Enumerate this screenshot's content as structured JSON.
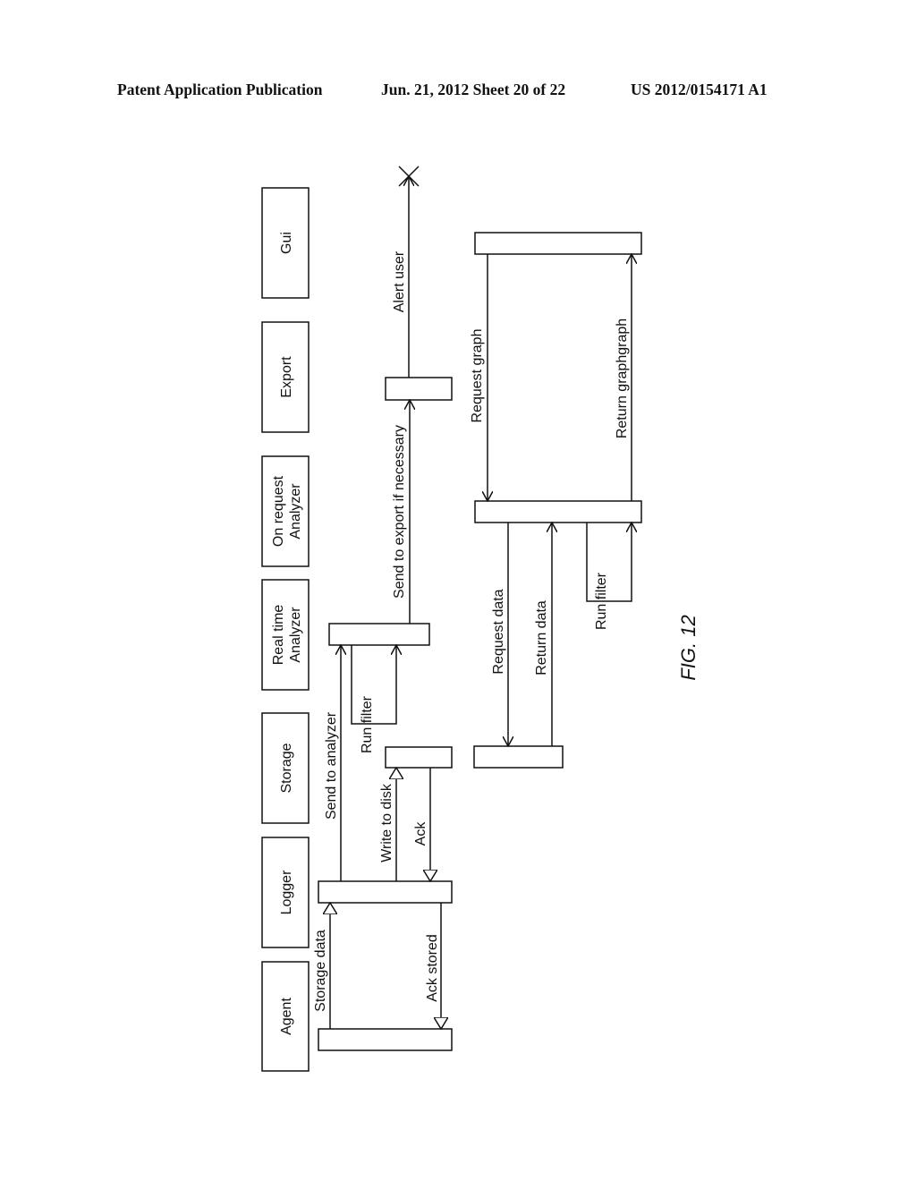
{
  "header": {
    "publication": "Patent Application Publication",
    "date_sheet": "Jun. 21, 2012  Sheet 20 of 22",
    "patent_number": "US 2012/0154171 A1"
  },
  "figure_label": "FIG. 12",
  "lifelines": [
    {
      "id": "gui",
      "lines": [
        "Gui"
      ]
    },
    {
      "id": "export",
      "lines": [
        "Export"
      ]
    },
    {
      "id": "on-request-analyzer",
      "lines": [
        "On request",
        "Analyzer"
      ]
    },
    {
      "id": "real-time-analyzer",
      "lines": [
        "Real time",
        "Analyzer"
      ]
    },
    {
      "id": "storage",
      "lines": [
        "Storage"
      ]
    },
    {
      "id": "logger",
      "lines": [
        "Logger"
      ]
    },
    {
      "id": "agent",
      "lines": [
        "Agent"
      ]
    }
  ],
  "messages": {
    "storage_data": "Storage data",
    "ack_stored": "Ack stored",
    "write_to_disk": "Write to disk",
    "ack": "Ack",
    "send_to_analyzer": "Send to analyzer",
    "run_filter_1": "Run filter",
    "send_to_export": "Send to export if necessary",
    "alert_user": "Alert user",
    "request_graph": "Request graph",
    "return_graph": "Return graphgraph",
    "request_data": "Request data",
    "return_data": "Return data",
    "run_filter_2": "Run filter"
  }
}
